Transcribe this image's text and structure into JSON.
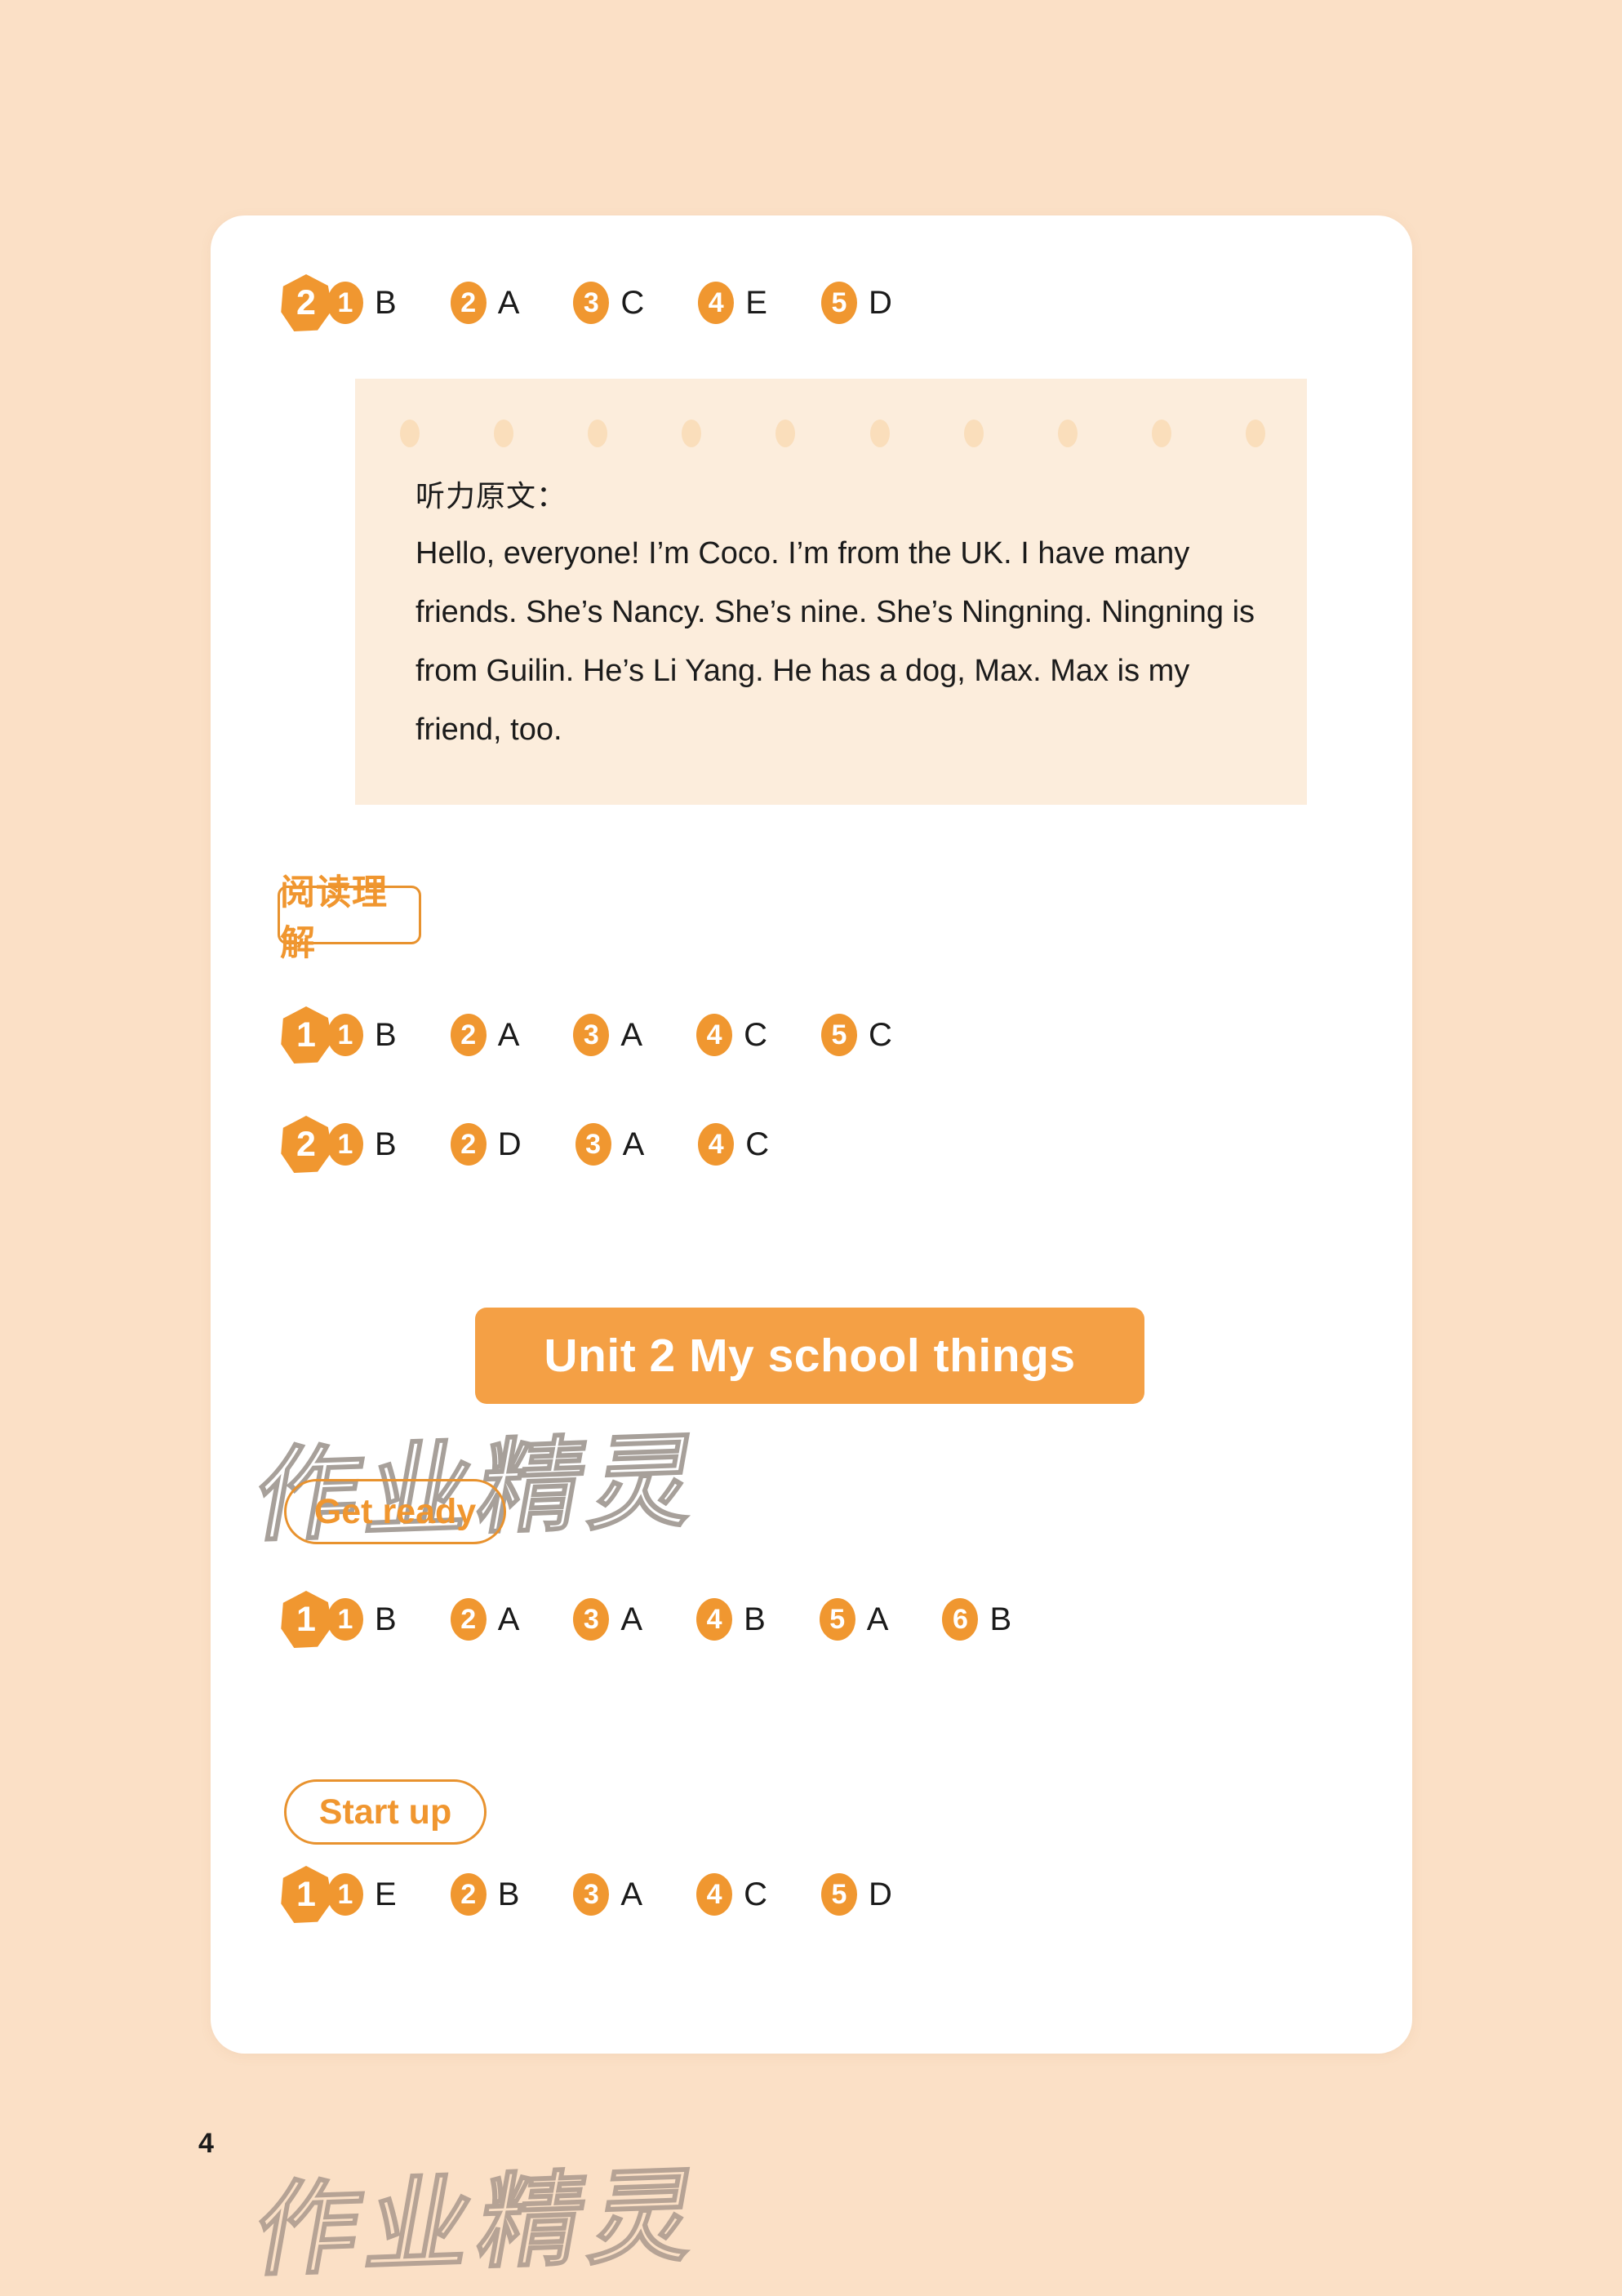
{
  "page": {
    "page_number": "4",
    "watermark_text": "作业精灵",
    "background_color": "#FBE0C6",
    "card_color": "#FFFFFF",
    "accent_color": "#F09730",
    "banner_color": "#F4A045",
    "transcript_box_color": "#FCEDDC"
  },
  "listening_answers": {
    "group_number": "2",
    "items": [
      {
        "num": "1",
        "answer": "B"
      },
      {
        "num": "2",
        "answer": "A"
      },
      {
        "num": "3",
        "answer": "C"
      },
      {
        "num": "4",
        "answer": "E"
      },
      {
        "num": "5",
        "answer": "D"
      }
    ]
  },
  "transcript": {
    "label": "听力原文：",
    "body": "Hello, everyone! I’m Coco. I’m from the UK. I have many friends. She’s Nancy. She’s nine. She’s Ningning. Ningning is from Guilin. He’s Li Yang. He has a dog, Max. Max is my friend, too.",
    "dot_count": 10
  },
  "reading_section": {
    "title": "阅读理解",
    "groups": [
      {
        "group_number": "1",
        "items": [
          {
            "num": "1",
            "answer": "B"
          },
          {
            "num": "2",
            "answer": "A"
          },
          {
            "num": "3",
            "answer": "A"
          },
          {
            "num": "4",
            "answer": "C"
          },
          {
            "num": "5",
            "answer": "C"
          }
        ]
      },
      {
        "group_number": "2",
        "items": [
          {
            "num": "1",
            "answer": "B"
          },
          {
            "num": "2",
            "answer": "D"
          },
          {
            "num": "3",
            "answer": "A"
          },
          {
            "num": "4",
            "answer": "C"
          }
        ]
      }
    ]
  },
  "unit_banner": {
    "title": "Unit 2  My school things"
  },
  "get_ready_section": {
    "title": "Get ready",
    "groups": [
      {
        "group_number": "1",
        "items": [
          {
            "num": "1",
            "answer": "B"
          },
          {
            "num": "2",
            "answer": "A"
          },
          {
            "num": "3",
            "answer": "A"
          },
          {
            "num": "4",
            "answer": "B"
          },
          {
            "num": "5",
            "answer": "A"
          },
          {
            "num": "6",
            "answer": "B"
          }
        ]
      }
    ]
  },
  "start_up_section": {
    "title": "Start up",
    "groups": [
      {
        "group_number": "1",
        "items": [
          {
            "num": "1",
            "answer": "E"
          },
          {
            "num": "2",
            "answer": "B"
          },
          {
            "num": "3",
            "answer": "A"
          },
          {
            "num": "4",
            "answer": "C"
          },
          {
            "num": "5",
            "answer": "D"
          }
        ]
      }
    ]
  }
}
